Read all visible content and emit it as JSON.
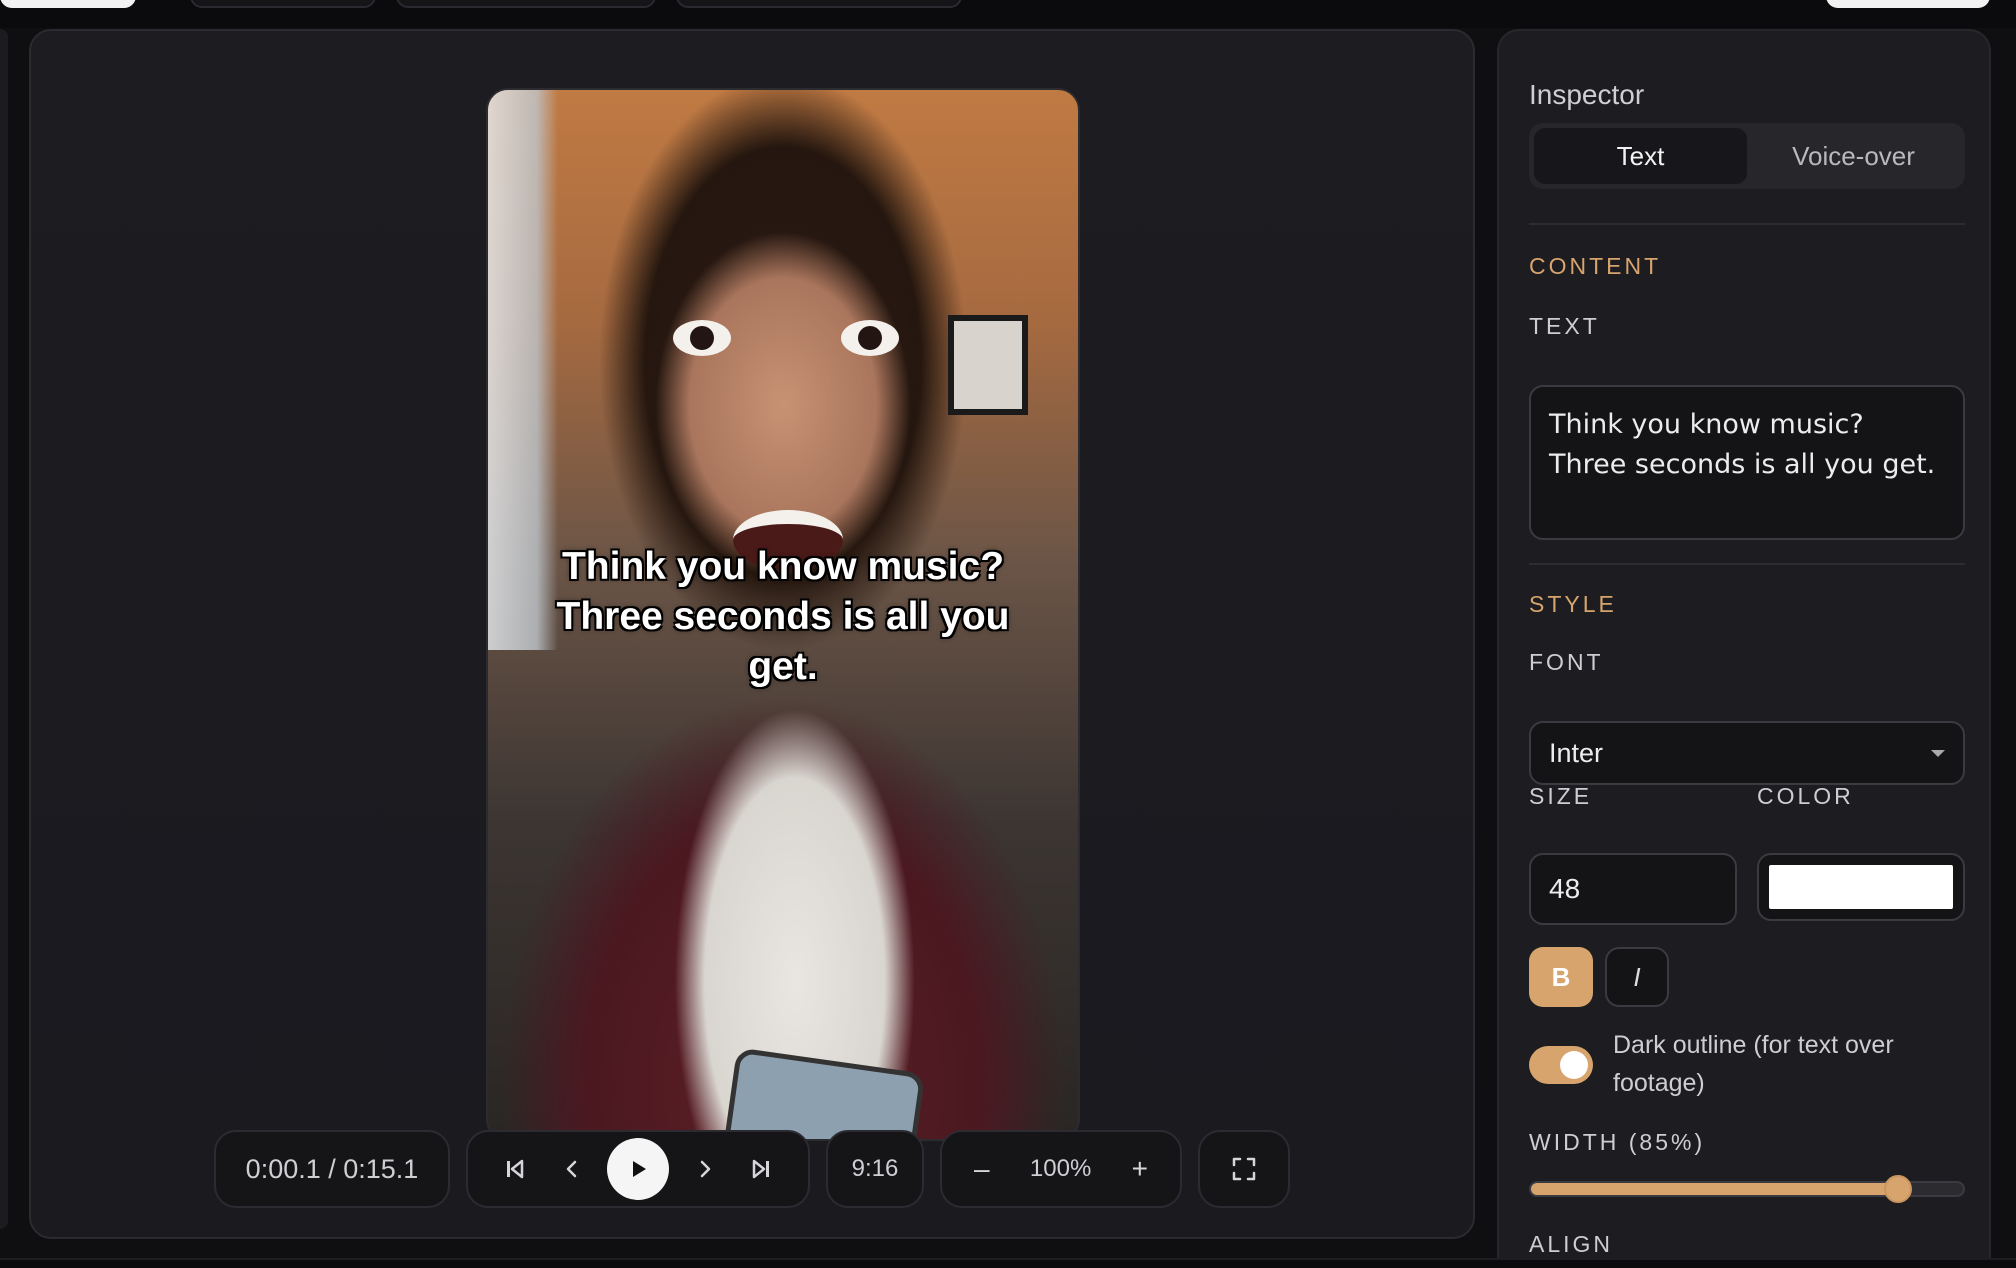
{
  "preview": {
    "caption": "Think you know music? Three seconds is all you get."
  },
  "controls": {
    "time": "0:00.1 / 0:15.1",
    "aspect_ratio": "9:16",
    "zoom": "100%",
    "zoom_out_label": "–",
    "zoom_in_label": "+"
  },
  "inspector": {
    "title": "Inspector",
    "tabs": [
      {
        "label": "Text",
        "active": true
      },
      {
        "label": "Voice-over",
        "active": false
      }
    ],
    "content_section": "CONTENT",
    "text_label": "TEXT",
    "text_value": "Think you know music? Three seconds is all you get.",
    "style_section": "STYLE",
    "font_label": "FONT",
    "font_value": "Inter",
    "size_label": "SIZE",
    "size_value": "48",
    "color_label": "COLOR",
    "color_value": "#ffffff",
    "bold_label": "B",
    "italic_label": "I",
    "bold_active": true,
    "outline_label": "Dark outline (for text over footage)",
    "outline_on": true,
    "width_label": "WIDTH (85%)",
    "width_percent": 85,
    "align_label": "ALIGN"
  },
  "colors": {
    "accent": "#d6a46c",
    "panel": "#1c1c21",
    "background": "#0f0f12"
  },
  "icons": {
    "skip_start": "skip-to-start-icon",
    "prev_frame": "chevron-left-icon",
    "play": "play-icon",
    "next_frame": "chevron-right-icon",
    "skip_end": "skip-to-end-icon",
    "fullscreen": "fullscreen-icon",
    "dropdown": "caret-down-icon"
  }
}
